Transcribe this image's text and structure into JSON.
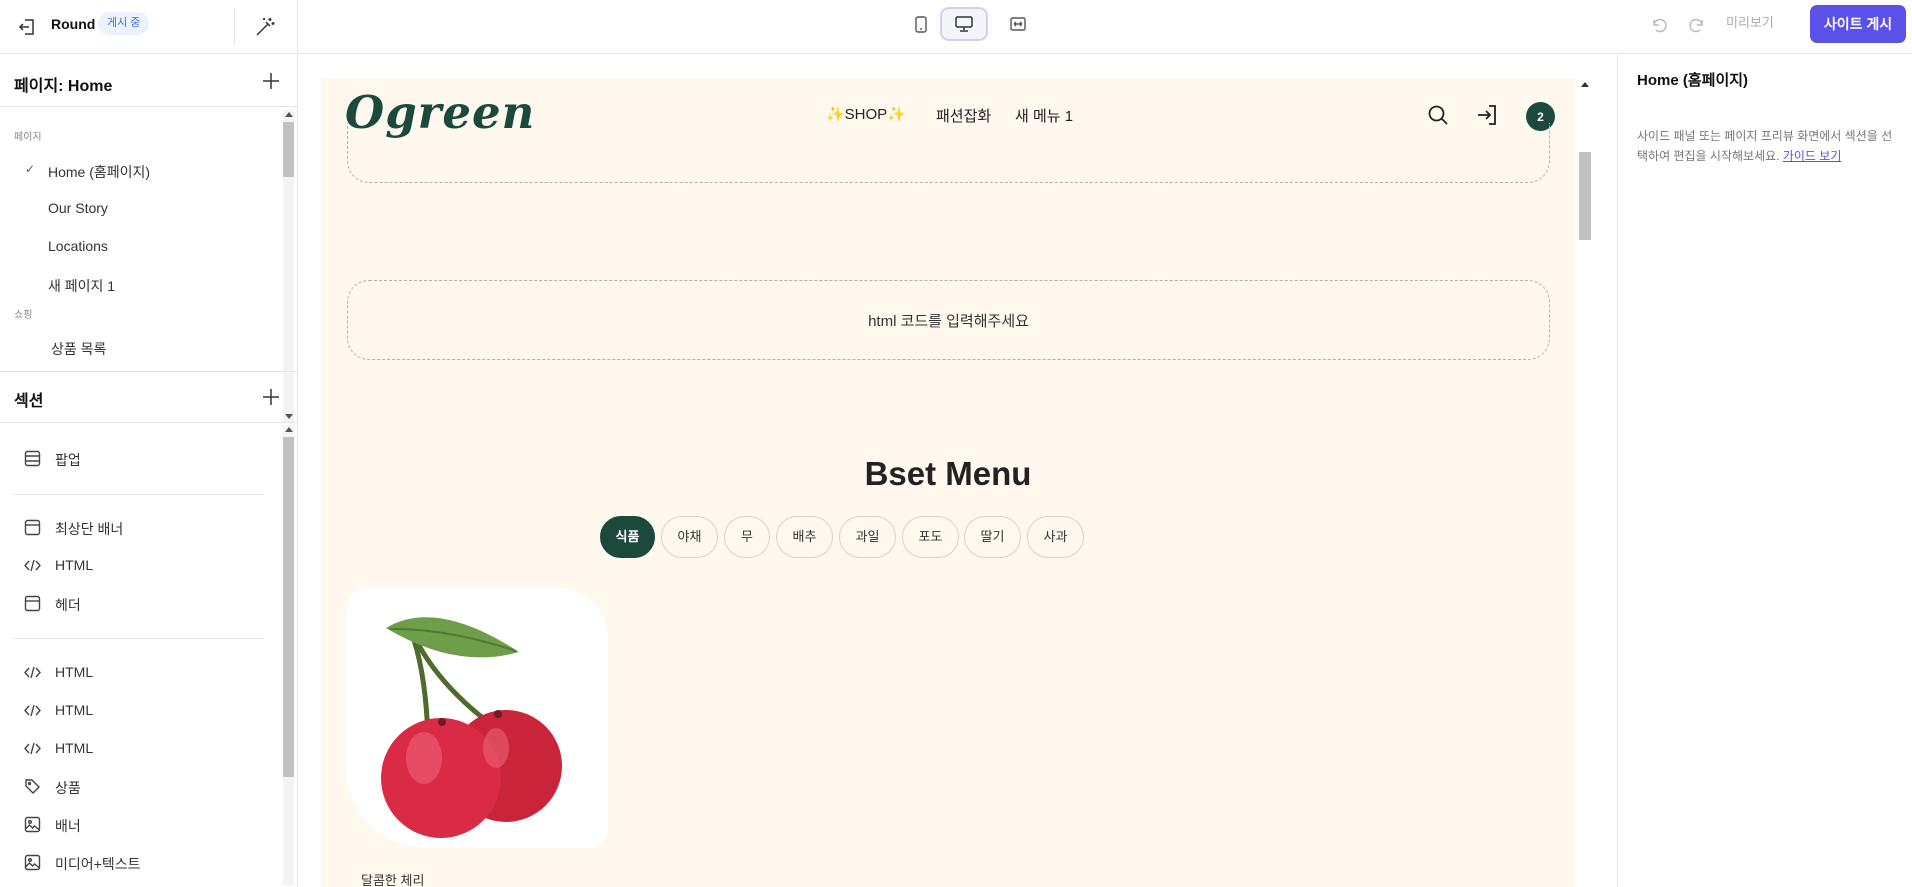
{
  "topbar": {
    "site_name": "Round",
    "status_badge": "게시 중",
    "preview_label": "미리보기",
    "publish_label": "사이트 게시",
    "accent_color": "#5b50e8"
  },
  "left_panel": {
    "pages_header": "페이지: Home",
    "pages_group_label": "페이지",
    "pages": [
      {
        "label": "Home (홈페이지)",
        "selected": true
      },
      {
        "label": "Our Story"
      },
      {
        "label": "Locations"
      },
      {
        "label": "새 페이지 1"
      }
    ],
    "shop_group_label": "쇼핑",
    "shop_pages": [
      {
        "label": "상품 목록"
      }
    ],
    "sections_header": "섹션",
    "sections": [
      {
        "label": "팝업",
        "icon": "layout-icon"
      },
      {
        "label": "최상단 배너",
        "icon": "browser-icon"
      },
      {
        "label": "HTML",
        "icon": "code-icon"
      },
      {
        "label": "헤더",
        "icon": "browser-icon"
      },
      {
        "label": "HTML",
        "icon": "code-icon"
      },
      {
        "label": "HTML",
        "icon": "code-icon"
      },
      {
        "label": "HTML",
        "icon": "code-icon"
      },
      {
        "label": "상품",
        "icon": "tag-icon"
      },
      {
        "label": "배너",
        "icon": "image-icon"
      },
      {
        "label": "미디어+텍스트",
        "icon": "image-icon"
      }
    ]
  },
  "preview": {
    "logo": "Ogreen",
    "nav": [
      "✨SHOP✨",
      "패션잡화",
      "새 메뉴 1"
    ],
    "cart_count": "2",
    "html_placeholder": "html 코드를 입력해주세요",
    "menu_title": "Bset Menu",
    "chips": [
      "식품",
      "야채",
      "무",
      "배추",
      "과일",
      "포도",
      "딸기",
      "사과"
    ],
    "active_chip": "식품",
    "product_name": "달콤한 체리",
    "brand_color": "#1b4a3c",
    "bg_color": "#fff8ee"
  },
  "right_panel": {
    "title": "Home (홈페이지)",
    "description": "사이드 패널 또는 페이지 프리뷰 화면에서 섹션을 선택하여 편집을 시작해보세요.",
    "guide_link": "가이드 보기"
  }
}
